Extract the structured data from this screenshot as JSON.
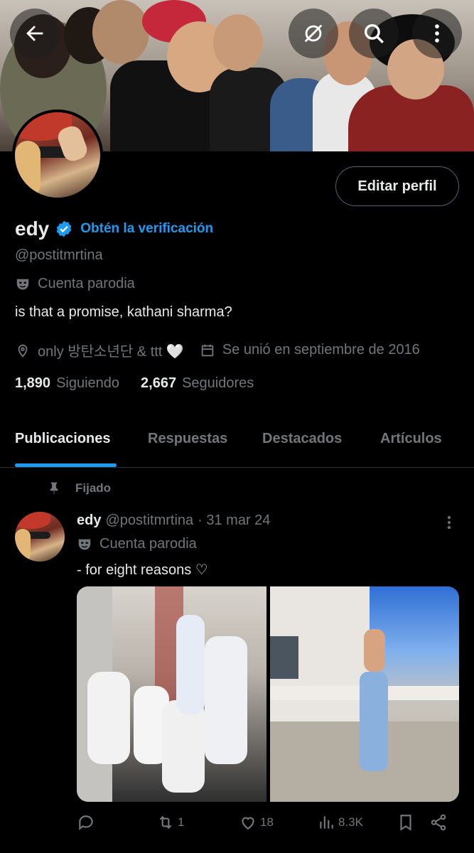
{
  "header": {
    "back_icon": "arrow-left-icon",
    "hide_icon": "eye-slash-icon",
    "search_icon": "search-icon",
    "more_icon": "more-vertical-icon"
  },
  "profile": {
    "edit_button": "Editar perfil",
    "display_name": "edy",
    "verify_label": "Obtén la verificación",
    "handle": "@postitmrtina",
    "parody_label": "Cuenta parodia",
    "bio": "is that a promise, kathani sharma?",
    "location": "only 방탄소년단 & ttt 🤍",
    "joined": "Se unió en septiembre de 2016",
    "following_count": "1,890",
    "following_label": "Siguiendo",
    "followers_count": "2,667",
    "followers_label": "Seguidores"
  },
  "tabs": [
    "Publicaciones",
    "Respuestas",
    "Destacados",
    "Artículos"
  ],
  "post": {
    "pinned_label": "Fijado",
    "name": "edy",
    "handle": "@postitmrtina",
    "date": "· 31 mar 24",
    "parody_label": "Cuenta parodia",
    "text": "- for eight reasons ♡",
    "reposts": "1",
    "likes": "18",
    "views": "8.3K"
  },
  "colors": {
    "accent": "#1d9bf0",
    "muted": "#71767b",
    "text": "#e7e9ea",
    "background": "#000000"
  }
}
